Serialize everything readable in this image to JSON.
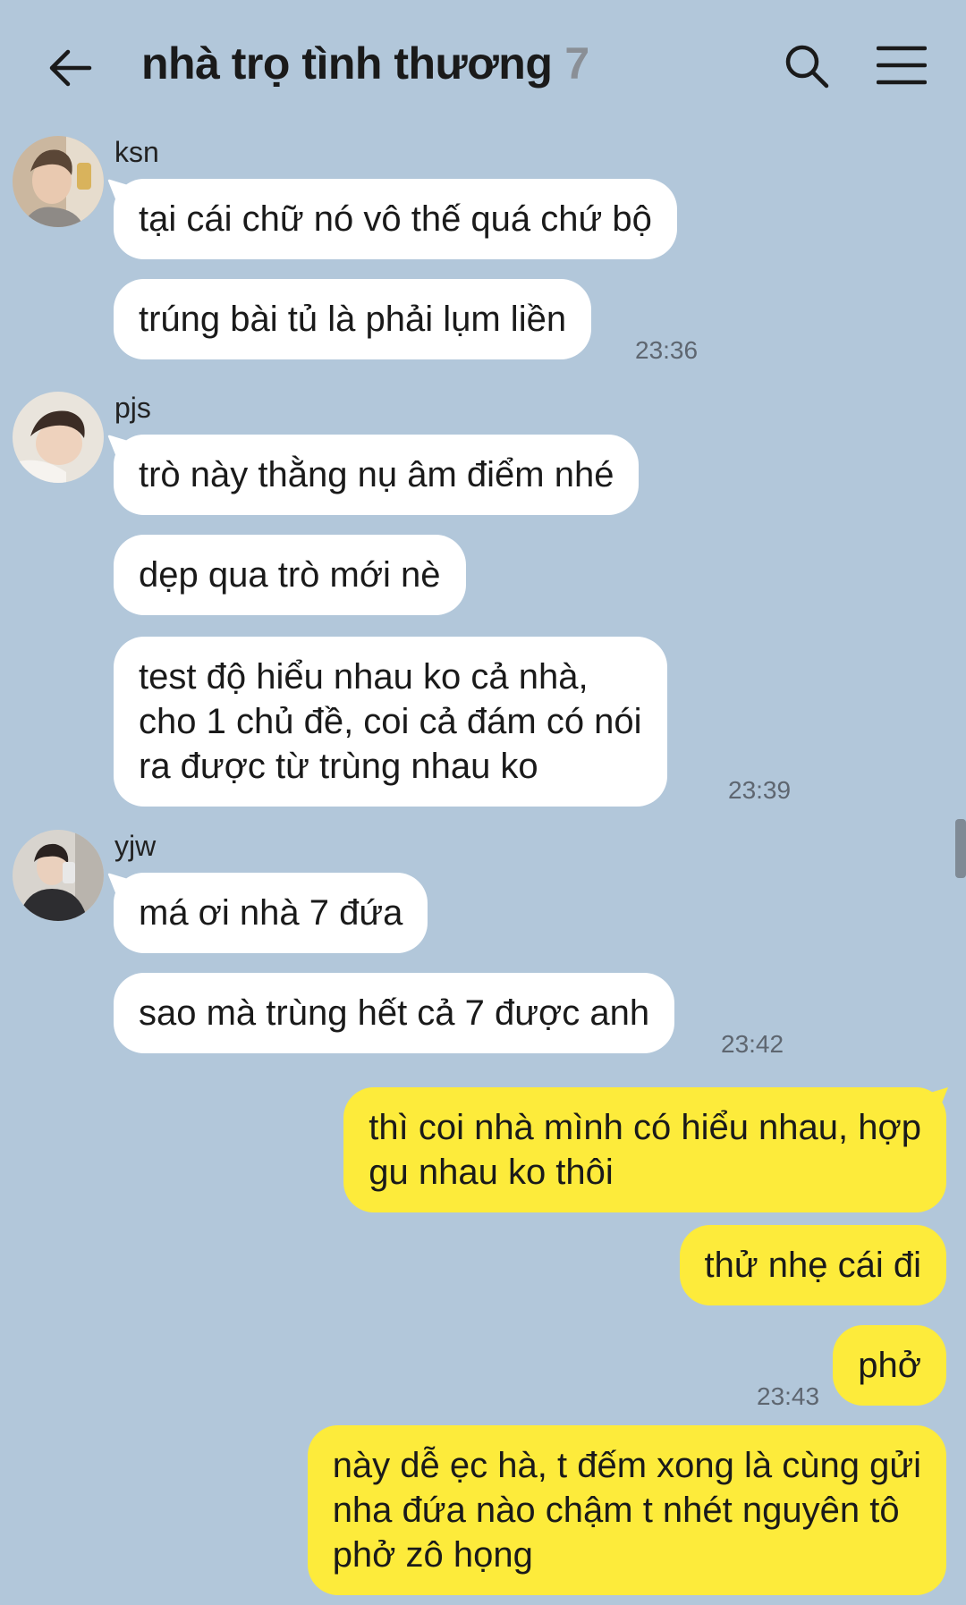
{
  "header": {
    "title": "nhà trọ tình thương",
    "member_count": "7"
  },
  "messages": [
    {
      "sender": "ksn",
      "text": "tại cái chữ nó vô thế quá chứ bộ"
    },
    {
      "sender": "ksn",
      "text": "trúng bài tủ là phải lụm liền",
      "time": "23:36"
    },
    {
      "sender": "pjs",
      "text": "trò này thằng nụ âm điểm nhé"
    },
    {
      "sender": "pjs",
      "text": "dẹp qua trò mới nè"
    },
    {
      "sender": "pjs",
      "lines": [
        "test độ hiểu nhau ko cả nhà,",
        "cho 1 chủ đề, coi cả đám có nói",
        "ra được từ trùng nhau ko"
      ],
      "time": "23:39"
    },
    {
      "sender": "yjw",
      "text": "má ơi nhà 7 đứa"
    },
    {
      "sender": "yjw",
      "text": "sao mà trùng hết cả 7 được anh",
      "time": "23:42"
    },
    {
      "sender": "me",
      "lines": [
        "thì coi nhà mình có hiểu nhau, hợp",
        "gu nhau ko thôi"
      ]
    },
    {
      "sender": "me",
      "text": "thử nhẹ cái đi"
    },
    {
      "sender": "me",
      "text": "phở",
      "time": "23:43"
    },
    {
      "sender": "me",
      "lines": [
        "này dễ ẹc hà, t đếm xong là cùng gửi",
        "nha đứa nào chậm t nhét nguyên tô",
        "phở zô họng"
      ]
    }
  ],
  "icons": {
    "back": "arrow-left-icon",
    "search": "search-icon",
    "menu": "hamburger-menu-icon"
  },
  "colors": {
    "background": "#b2c7da",
    "incoming_bubble": "#ffffff",
    "outgoing_bubble": "#fdeb3b",
    "timestamp": "#5e6670"
  }
}
